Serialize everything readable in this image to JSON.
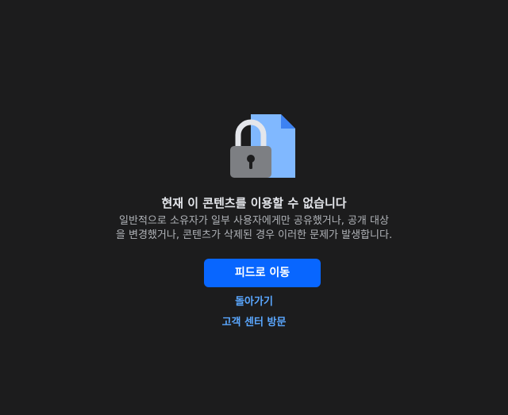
{
  "error": {
    "title": "현재 이 콘텐츠를 이용할 수 없습니다",
    "description_line1": "일반적으로 소유자가 일부 사용자에게만 공유했거나, 공개 대상",
    "description_line2": "을 변경했거나, 콘텐츠가 삭제된 경우 이러한 문제가 발생합니다."
  },
  "actions": {
    "primary_label": "피드로 이동",
    "back_label": "돌아가기",
    "help_label": "고객 센터 방문"
  },
  "icons": {
    "illustration": "locked-document-icon"
  },
  "colors": {
    "background": "#1c1c1d",
    "accent": "#0866ff",
    "link": "#5aa7ff",
    "document": "#80b8ff",
    "lock_body": "#7d7f83"
  }
}
